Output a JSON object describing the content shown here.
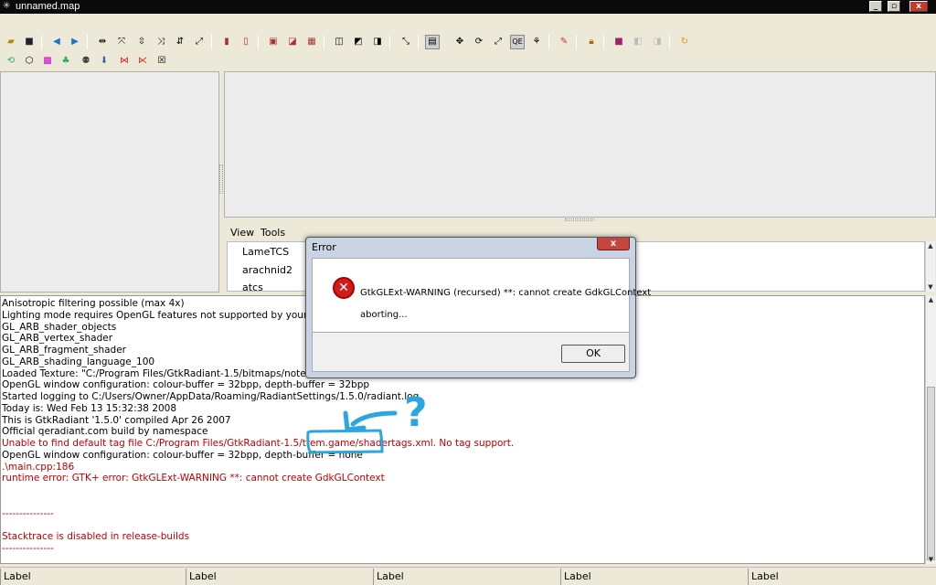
{
  "window": {
    "title": "unnamed.map",
    "app_icon": "radiant-icon"
  },
  "menubar": {
    "view": "View",
    "tools": "Tools"
  },
  "shader_list": [
    "LameTCS",
    "arachnid2",
    "atcs"
  ],
  "console_lines": [
    {
      "text": "Anisotropic filtering possible (max 4x)",
      "error": false
    },
    {
      "text": "Lighting mode requires OpenGL features not supported by your graphics",
      "error": false
    },
    {
      "text": "  GL_ARB_shader_objects",
      "error": false
    },
    {
      "text": "  GL_ARB_vertex_shader",
      "error": false
    },
    {
      "text": "  GL_ARB_fragment_shader",
      "error": false
    },
    {
      "text": "  GL_ARB_shading_language_100",
      "error": false
    },
    {
      "text": "Loaded Texture: \"C:/Program Files/GtkRadiant-1.5/bitmaps/notex.bmp\"",
      "error": false
    },
    {
      "text": "OpenGL window configuration: colour-buffer = 32bpp, depth-buffer = 32bpp",
      "error": false
    },
    {
      "text": "Started logging to C:/Users/Owner/AppData/Roaming/RadiantSettings/1.5.0/radiant.log",
      "error": false
    },
    {
      "text": "Today is: Wed Feb 13 15:32:38 2008",
      "error": false
    },
    {
      "text": "This is GtkRadiant '1.5.0' compiled Apr 26 2007",
      "error": false
    },
    {
      "text": "Official qeradiant.com build by namespace",
      "error": false
    },
    {
      "text": "Unable to find default tag file C:/Program Files/GtkRadiant-1.5/trem.game/shadertags.xml. No tag support.",
      "error": true
    },
    {
      "text": "OpenGL window configuration: colour-buffer = 32bpp, depth-buffer = none",
      "error": false
    },
    {
      "text": ".\\main.cpp:186",
      "error": true
    },
    {
      "text": "runtime error: GTK+ error: GtkGLExt-WARNING **: cannot create GdkGLContext",
      "error": true
    },
    {
      "text": "",
      "error": false
    },
    {
      "text": "",
      "error": false
    },
    {
      "text": "---------------",
      "error": true
    },
    {
      "text": "",
      "error": false
    },
    {
      "text": "Stacktrace is disabled in release-builds",
      "error": true
    },
    {
      "text": "---------------",
      "error": true
    }
  ],
  "dialog": {
    "title": "Error",
    "close_label": "x",
    "message": "GtkGLExt-WARNING (recursed) **: cannot create GdkGLContext",
    "submessage": "aborting...",
    "ok_label": "OK"
  },
  "annotation": {
    "mark": "?",
    "color": "#2aa7e0"
  },
  "statusbar": [
    "Label",
    "Label",
    "Label",
    "Label",
    "Label"
  ],
  "colors": {
    "error_text": "#c00000",
    "annotation": "#2aa7e0"
  }
}
